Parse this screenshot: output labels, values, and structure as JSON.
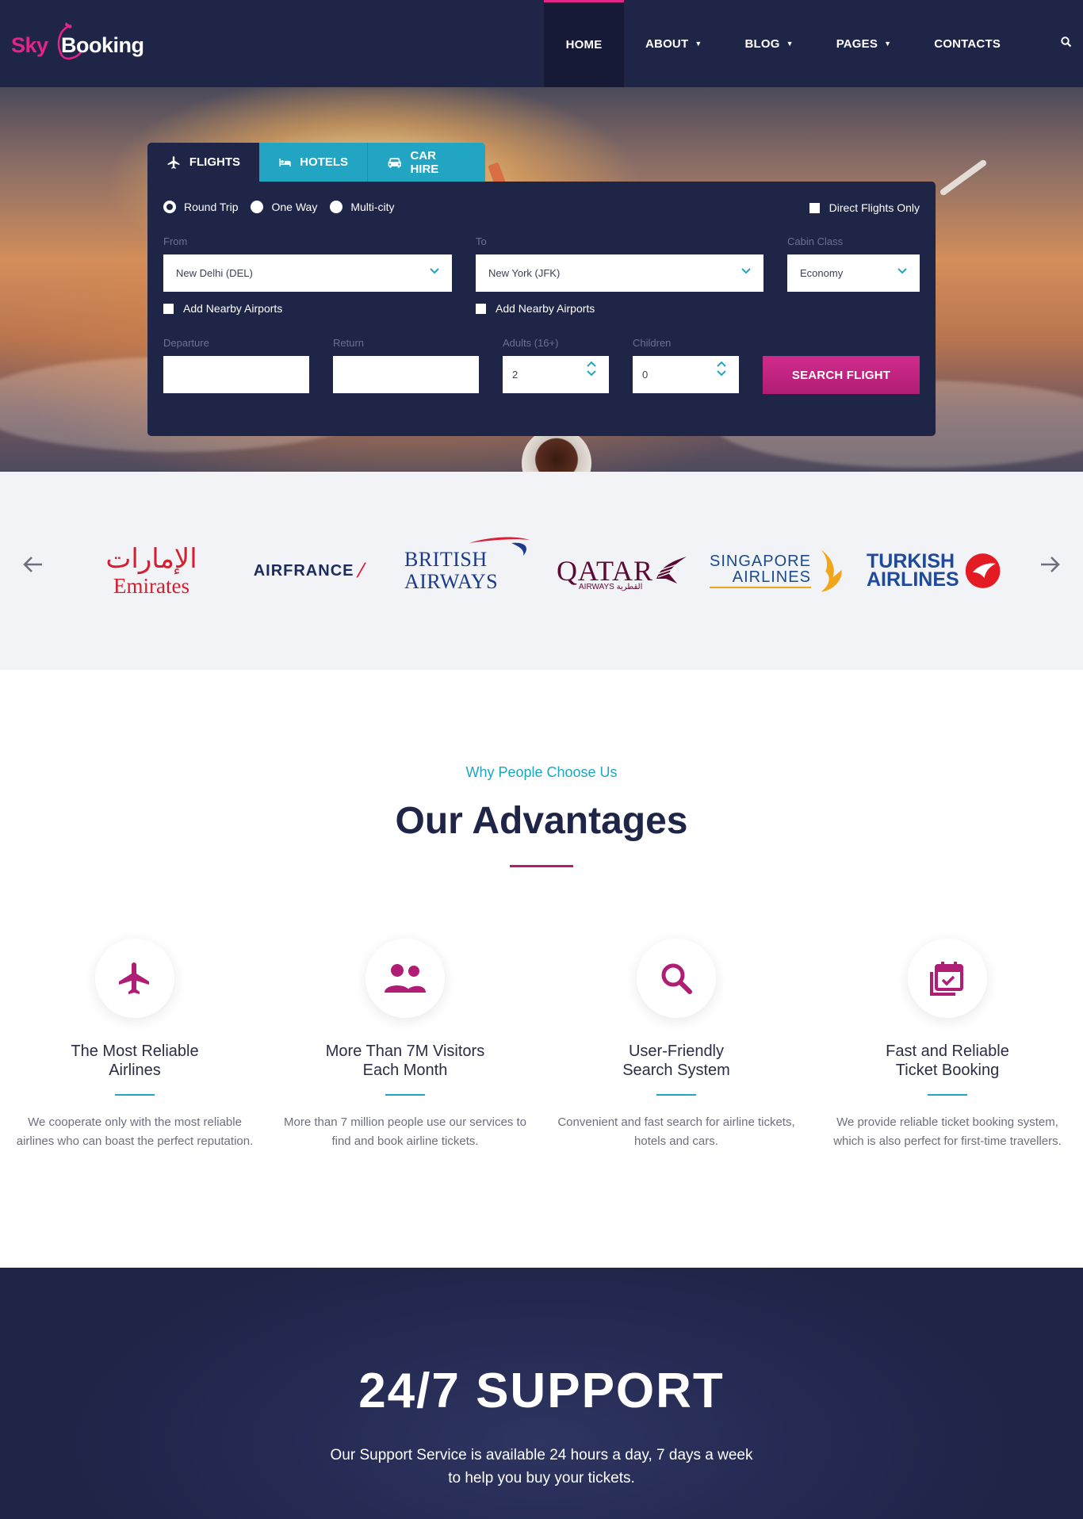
{
  "brand": {
    "logo_part1": "Sky",
    "logo_part2": "Booking",
    "accent": "#e3258a",
    "navy": "#1f2547",
    "teal": "#22a5c2"
  },
  "nav": {
    "items": [
      {
        "label": "HOME",
        "active": true
      },
      {
        "label": "ABOUT",
        "dropdown": true
      },
      {
        "label": "BLOG",
        "dropdown": true
      },
      {
        "label": "PAGES",
        "dropdown": true
      },
      {
        "label": "CONTACTS"
      }
    ],
    "search_icon": "search-icon"
  },
  "booking": {
    "tabs": [
      {
        "label": "FLIGHTS",
        "icon": "plane-icon",
        "active": true
      },
      {
        "label": "HOTELS",
        "icon": "bed-icon"
      },
      {
        "label": "CAR HIRE",
        "icon": "car-icon"
      }
    ],
    "trip_types": [
      {
        "label": "Round Trip",
        "checked": true
      },
      {
        "label": "One Way"
      },
      {
        "label": "Multi-city"
      }
    ],
    "direct_only": "Direct Flights Only",
    "from": {
      "label": "From",
      "value": "New Delhi (DEL)"
    },
    "to": {
      "label": "To",
      "value": "New York (JFK)"
    },
    "cabin": {
      "label": "Cabin Class",
      "value": "Economy"
    },
    "nearby_label": "Add Nearby Airports",
    "departure": {
      "label": "Departure",
      "value": ""
    },
    "return": {
      "label": "Return",
      "value": ""
    },
    "adults": {
      "label": "Adults (16+)",
      "value": "2"
    },
    "children": {
      "label": "Children",
      "value": "0"
    },
    "submit": "SEARCH FLIGHT"
  },
  "airlines": {
    "logos": [
      {
        "name": "Emirates"
      },
      {
        "name": "AIRFRANCE"
      },
      {
        "line1": "BRITISH",
        "line2": "AIRWAYS"
      },
      {
        "name": "QATAR",
        "sub": "AIRWAYS القطرية"
      },
      {
        "line1": "SINGAPORE",
        "line2": "AIRLINES"
      },
      {
        "line1": "TURKISH",
        "line2": "AIRLINES"
      }
    ]
  },
  "advantages": {
    "eyebrow": "Why People Choose Us",
    "title": "Our Advantages",
    "features": [
      {
        "icon": "plane-icon",
        "title_l1": "The Most Reliable",
        "title_l2": "Airlines",
        "text": "We cooperate only with the most reliable airlines who can boast the perfect reputation."
      },
      {
        "icon": "users-icon",
        "title_l1": "More Than 7M Visitors",
        "title_l2": "Each Month",
        "text": "More than 7 million people use our services to find and book airline tickets."
      },
      {
        "icon": "search-icon",
        "title_l1": "User-Friendly",
        "title_l2": "Search System",
        "text": "Convenient and fast search for airline tickets, hotels and cars."
      },
      {
        "icon": "calendar-check-icon",
        "title_l1": "Fast and Reliable",
        "title_l2": "Ticket Booking",
        "text": "We provide reliable ticket booking system, which is also perfect for first-time travellers."
      }
    ]
  },
  "support": {
    "title": "24/7 SUPPORT",
    "line1": "Our Support Service is available 24 hours a day, 7 days a week",
    "line2": "to help you buy your tickets."
  }
}
